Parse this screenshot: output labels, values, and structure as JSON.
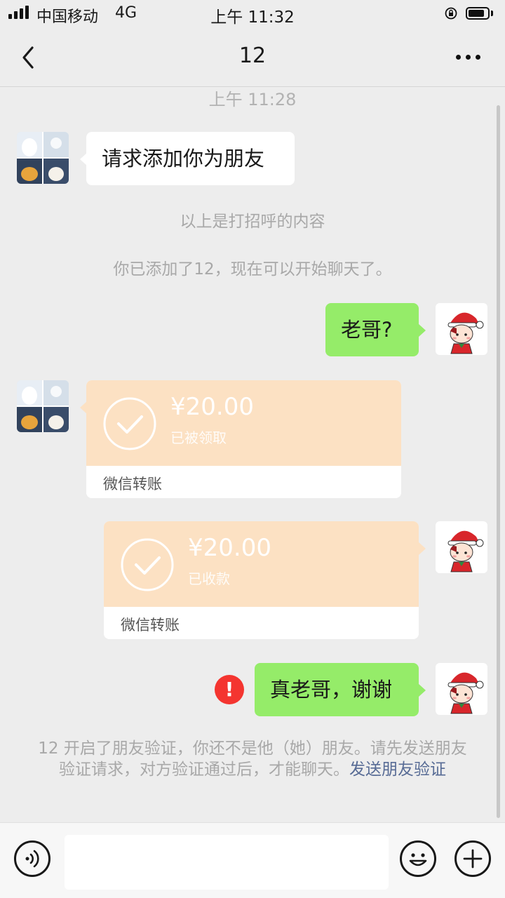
{
  "status_bar": {
    "carrier": "中国移动",
    "network": "4G",
    "time": "上午 11:32"
  },
  "nav": {
    "title": "12",
    "back_icon": "chevron-left-icon",
    "more_icon": "more-dots-icon"
  },
  "chat": {
    "timestamp": "上午 11:28",
    "messages": [
      {
        "side": "left",
        "type": "text",
        "text": "请求添加你为朋友"
      },
      {
        "type": "system",
        "text": "以上是打招呼的内容"
      },
      {
        "type": "system",
        "text": "你已添加了12，现在可以开始聊天了。"
      },
      {
        "side": "right",
        "type": "text",
        "text": "老哥?"
      },
      {
        "side": "left",
        "type": "transfer",
        "amount": "¥20.00",
        "status": "已被领取",
        "label": "微信转账"
      },
      {
        "side": "right",
        "type": "transfer",
        "amount": "¥20.00",
        "status": "已收款",
        "label": "微信转账"
      },
      {
        "side": "right",
        "type": "text",
        "text": "真老哥，谢谢",
        "error": "!"
      }
    ],
    "notice": {
      "text": "12 开启了朋友验证，你还不是他（她）朋友。请先发送朋友验证请求，对方验证通过后，才能聊天。",
      "link": "发送朋友验证"
    }
  },
  "colors": {
    "background": "#ededed",
    "bubble_green": "#95ec69",
    "transfer_bg": "#fce1c3",
    "error_red": "#f43530",
    "link": "#576b95"
  },
  "input_bar": {
    "voice_icon": "voice-icon",
    "emoji_icon": "emoji-icon",
    "plus_icon": "plus-icon"
  }
}
